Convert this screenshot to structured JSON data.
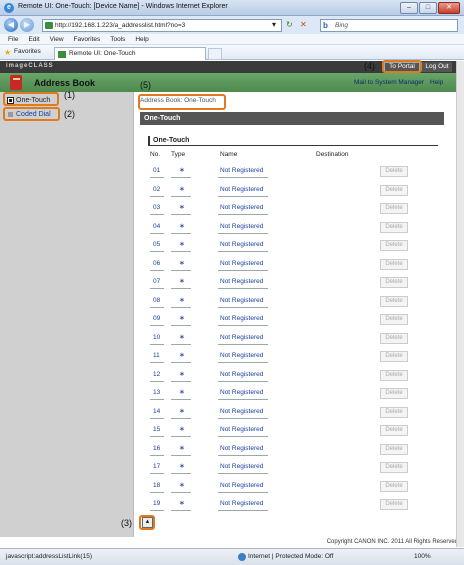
{
  "window": {
    "title": "Remote UI: One-Touch: [Device Name] - Windows Internet Explorer",
    "url": "http://192.168.1.223/a_addresslist.html?no=3",
    "search_placeholder": "Bing"
  },
  "menu": [
    "File",
    "Edit",
    "View",
    "Favorites",
    "Tools",
    "Help"
  ],
  "favorites_label": "Favorites",
  "tab_label": "Remote UI: One-Touch",
  "header": {
    "device": "imageCLASS",
    "to_portal": "To Portal",
    "log_out": "Log Out",
    "app_title": "Address Book",
    "mail_to_admin": "Mail to System Manager",
    "help": "Help"
  },
  "sidebar": {
    "items": [
      {
        "label": "One-Touch"
      },
      {
        "label": "Coded Dial"
      }
    ]
  },
  "main": {
    "breadcrumb": "Address Book: One-Touch",
    "section_title": "One-Touch",
    "table_title": "One-Touch",
    "columns": {
      "no": "No.",
      "type": "Type",
      "name": "Name",
      "destination": "Destination"
    },
    "rows": [
      {
        "no": "01",
        "type": "∗",
        "name": "Not Registered",
        "action": "Delete"
      },
      {
        "no": "02",
        "type": "∗",
        "name": "Not Registered",
        "action": "Delete"
      },
      {
        "no": "03",
        "type": "∗",
        "name": "Not Registered",
        "action": "Delete"
      },
      {
        "no": "04",
        "type": "∗",
        "name": "Not Registered",
        "action": "Delete"
      },
      {
        "no": "05",
        "type": "∗",
        "name": "Not Registered",
        "action": "Delete"
      },
      {
        "no": "06",
        "type": "∗",
        "name": "Not Registered",
        "action": "Delete"
      },
      {
        "no": "07",
        "type": "∗",
        "name": "Not Registered",
        "action": "Delete"
      },
      {
        "no": "08",
        "type": "∗",
        "name": "Not Registered",
        "action": "Delete"
      },
      {
        "no": "09",
        "type": "∗",
        "name": "Not Registered",
        "action": "Delete"
      },
      {
        "no": "10",
        "type": "∗",
        "name": "Not Registered",
        "action": "Delete"
      },
      {
        "no": "11",
        "type": "∗",
        "name": "Not Registered",
        "action": "Delete"
      },
      {
        "no": "12",
        "type": "∗",
        "name": "Not Registered",
        "action": "Delete"
      },
      {
        "no": "13",
        "type": "∗",
        "name": "Not Registered",
        "action": "Delete"
      },
      {
        "no": "14",
        "type": "∗",
        "name": "Not Registered",
        "action": "Delete"
      },
      {
        "no": "15",
        "type": "∗",
        "name": "Not Registered",
        "action": "Delete"
      },
      {
        "no": "16",
        "type": "∗",
        "name": "Not Registered",
        "action": "Delete"
      },
      {
        "no": "17",
        "type": "∗",
        "name": "Not Registered",
        "action": "Delete"
      },
      {
        "no": "18",
        "type": "∗",
        "name": "Not Registered",
        "action": "Delete"
      },
      {
        "no": "19",
        "type": "∗",
        "name": "Not Registered",
        "action": "Delete"
      }
    ]
  },
  "callouts": [
    "(1)",
    "(2)",
    "(3)",
    "(4)",
    "(5)"
  ],
  "copyright": "Copyright CANON INC. 2011 All Rights Reserved",
  "status": {
    "link": "javascript:addressListLink(15)",
    "zone": "Internet | Protected Mode: Off",
    "zoom": "100%"
  },
  "colors": {
    "accent_green": "#5a985a",
    "callout": "#e07a1f",
    "link": "#1a3fa0"
  }
}
